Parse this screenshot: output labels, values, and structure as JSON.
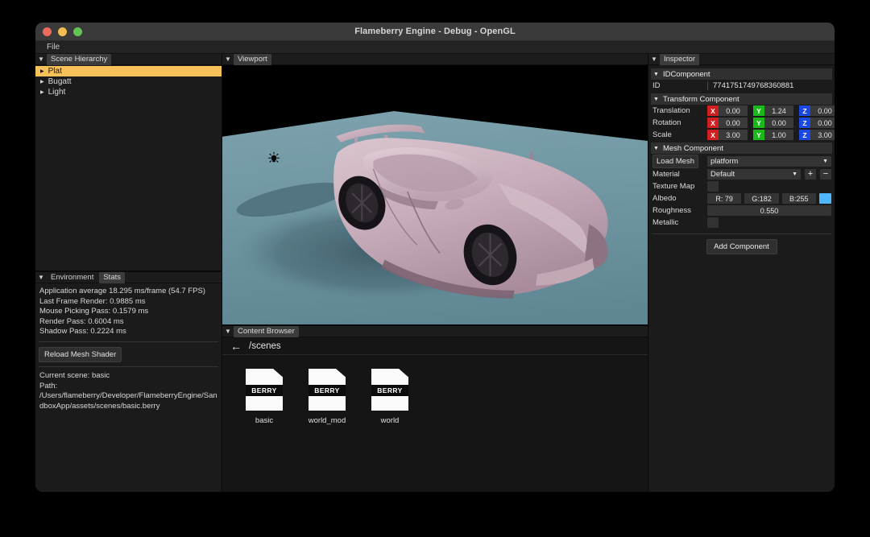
{
  "window": {
    "title": "Flameberry Engine - Debug - OpenGL",
    "traffic_lights": [
      "close",
      "minimize",
      "zoom"
    ],
    "menu": [
      "File"
    ]
  },
  "scene_hierarchy": {
    "panel_title": "Scene Hierarchy",
    "items": [
      {
        "label": "Plat",
        "selected": true
      },
      {
        "label": "Bugatt",
        "selected": false
      },
      {
        "label": "Light",
        "selected": false
      }
    ]
  },
  "stats_panel": {
    "tabs": [
      {
        "label": "Environment",
        "active": false
      },
      {
        "label": "Stats",
        "active": true
      }
    ],
    "lines": [
      "Application average 18.295 ms/frame (54.7 FPS)",
      "Last Frame Render: 0.9885 ms",
      "Mouse Picking Pass: 0.1579 ms",
      "Render Pass: 0.6004 ms",
      "Shadow Pass: 0.2224 ms"
    ],
    "reload_button": "Reload Mesh Shader",
    "current_scene": "Current scene: basic",
    "path_label": "Path:",
    "path_value": "/Users/flameberry/Developer/FlameberryEngine/SandboxApp/assets/scenes/basic.berry"
  },
  "viewport": {
    "panel_title": "Viewport",
    "colors": {
      "sky": "#000000",
      "ground": "#6d94a2",
      "car": "#c9aebb",
      "shadow": "#4a6773"
    }
  },
  "content_browser": {
    "panel_title": "Content Browser",
    "path": "/scenes",
    "back_icon": "←",
    "files": [
      {
        "name": "basic",
        "type": "BERRY"
      },
      {
        "name": "world_mod",
        "type": "BERRY"
      },
      {
        "name": "world",
        "type": "BERRY"
      }
    ]
  },
  "inspector": {
    "panel_title": "Inspector",
    "id_component": {
      "header": "IDComponent",
      "id_label": "ID",
      "id_value": "7741751749768360881"
    },
    "transform_component": {
      "header": "Transform Component",
      "rows": [
        {
          "label": "Translation",
          "x": "0.00",
          "y": "1.24",
          "z": "0.00"
        },
        {
          "label": "Rotation",
          "x": "0.00",
          "y": "0.00",
          "z": "0.00"
        },
        {
          "label": "Scale",
          "x": "3.00",
          "y": "1.00",
          "z": "3.00"
        }
      ],
      "axis_labels": {
        "x": "X",
        "y": "Y",
        "z": "Z"
      },
      "axis_colors": {
        "x": "#d11f1f",
        "y": "#1ab81a",
        "z": "#1b48e0"
      }
    },
    "mesh_component": {
      "header": "Mesh Component",
      "load_mesh_button": "Load Mesh",
      "mesh_value": "platform",
      "material_label": "Material",
      "material_value": "Default",
      "add_material_icon": "+",
      "remove_material_icon": "−",
      "texture_map_label": "Texture Map",
      "albedo_label": "Albedo",
      "albedo_r": "R: 79",
      "albedo_g": "G:182",
      "albedo_b": "B:255",
      "albedo_color": "#4fb6ff",
      "roughness_label": "Roughness",
      "roughness_value": "0.550",
      "metallic_label": "Metallic"
    },
    "add_component_button": "Add Component"
  }
}
